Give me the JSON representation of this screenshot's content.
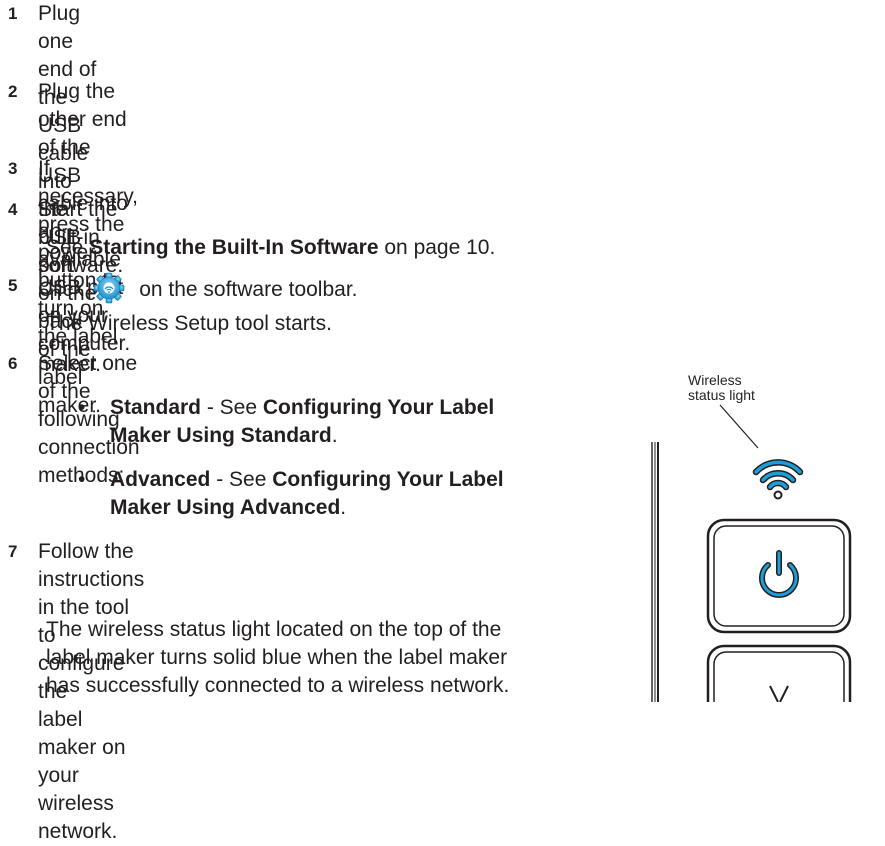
{
  "steps": [
    {
      "num": "1",
      "lines": [
        "Plug one end of the USB cable into the USB port on the back of the label",
        "maker."
      ]
    },
    {
      "num": "2",
      "lines": [
        "Plug the other end of the USB cable into an available USB port on your",
        "computer."
      ]
    },
    {
      "num": "3",
      "lines": [
        "If necessary, press the power button to turn on the label maker."
      ]
    },
    {
      "num": "4",
      "lines": [
        "Start the built-in software."
      ]
    },
    {
      "num": "5",
      "pre": "Click",
      "icon": "wireless-setup-gear-icon",
      "post": "on the software toolbar."
    },
    {
      "num": "6",
      "lines": [
        "Select one of the following connection methods:"
      ]
    },
    {
      "num": "7",
      "lines": [
        "Follow the instructions in the tool to configure the",
        "label maker on your wireless network."
      ]
    }
  ],
  "step4_note": {
    "pre": "See ",
    "link": "Starting the Built-In Software",
    "post": " on page 10."
  },
  "step5_note": "The Wireless Setup tool starts.",
  "bullets": [
    {
      "term": "Standard",
      "sep": " - See ",
      "link_line1": "Configuring Your Label",
      "link_line2": "Maker Using Standard",
      "end": "."
    },
    {
      "term": "Advanced",
      "sep": " - See ",
      "link_line1": "Configuring Your Label",
      "link_line2": "Maker Using Advanced",
      "end": "."
    }
  ],
  "step7_note": [
    "The wireless status light located on the top of the",
    "label maker turns solid blue when the label maker",
    "has successfully connected to a wireless network."
  ],
  "figure": {
    "callout_line1": "Wireless",
    "callout_line2": "status light",
    "icons": [
      "wireless-status-light-icon",
      "power-button-icon"
    ],
    "accent": "#1a9fd8"
  }
}
